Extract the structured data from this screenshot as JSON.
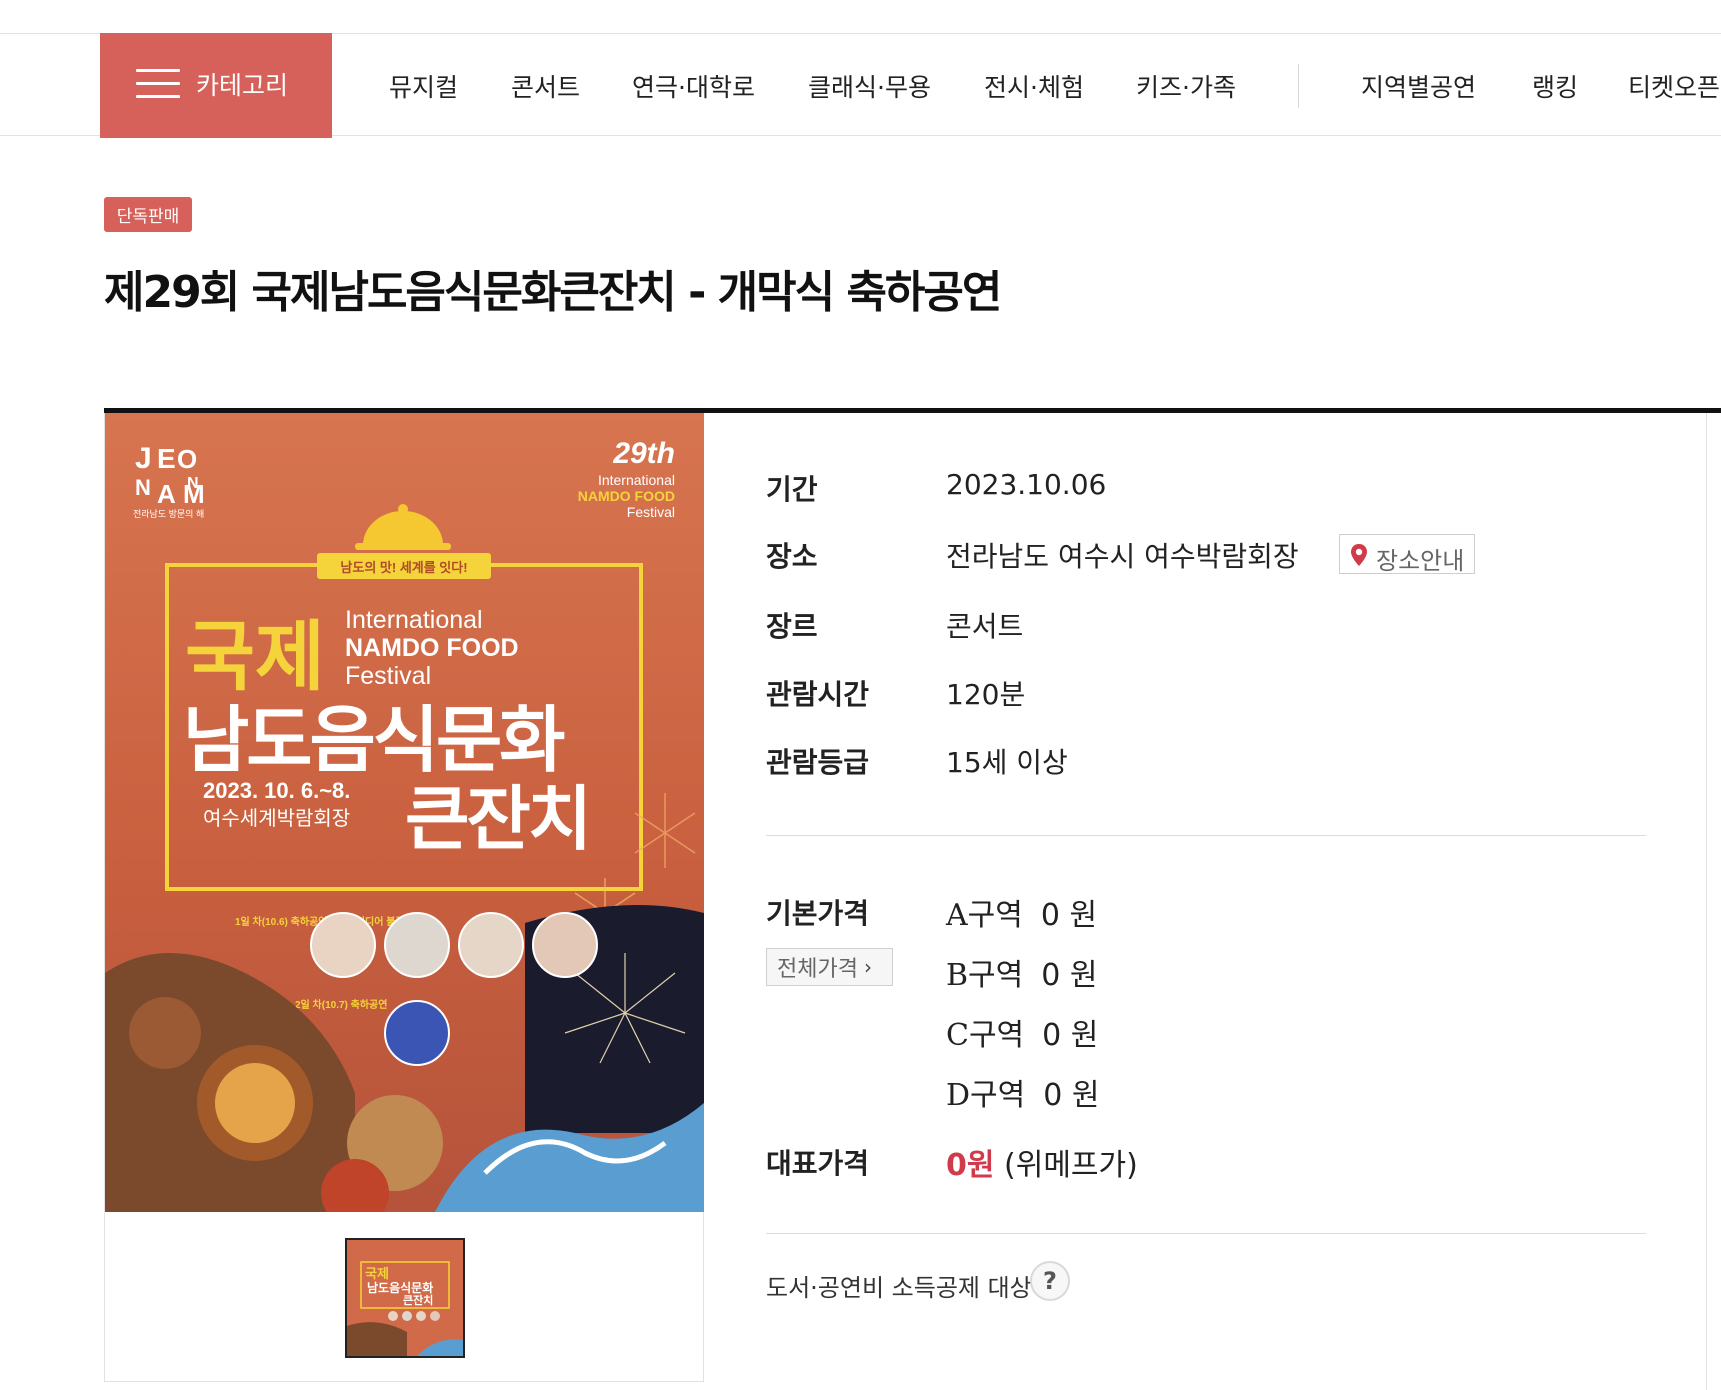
{
  "nav": {
    "category_label": "카테고리",
    "items": [
      "뮤지컬",
      "콘서트",
      "연극·대학로",
      "클래식·무용",
      "전시·체험",
      "키즈·가족",
      "지역별공연",
      "랭킹",
      "티켓오픈"
    ]
  },
  "event": {
    "badge": "단독판매",
    "title": "제29회 국제남도음식문화큰잔치 - 개막식 축하공연"
  },
  "poster": {
    "logo_letters": [
      "J",
      "E",
      "O",
      "N",
      "A",
      "M"
    ],
    "logo_sub": "전라남도 방문의 해",
    "edition": "29th",
    "edition_sub": [
      "International",
      "NAMDO FOOD",
      "Festival"
    ],
    "ribbon": "남도의 맛! 세계를 잇다!",
    "big1": "국제",
    "en_lines": [
      "International",
      "NAMDO FOOD",
      "Festival"
    ],
    "big2": "남도음식문화",
    "big3": "큰잔치",
    "dates": "2023. 10. 6.~8.",
    "place": "여수세계박람회장",
    "day1": "1일 차(10.6) 축하공연& 멀티미디어 불꽃쇼",
    "day2": "2일 차(10.7) 축하공연"
  },
  "info": {
    "period": {
      "label": "기간",
      "value": "2023.10.06"
    },
    "venue": {
      "label": "장소",
      "value": "전라남도 여수시 여수박람회장",
      "guide": "장소안내"
    },
    "genre": {
      "label": "장르",
      "value": "콘서트"
    },
    "runtime": {
      "label": "관람시간",
      "value": "120분"
    },
    "rating": {
      "label": "관람등급",
      "value": "15세 이상"
    }
  },
  "price": {
    "label": "기본가격",
    "all_button": "전체가격",
    "zones": [
      {
        "zone": "A구역",
        "amount": "0 원"
      },
      {
        "zone": "B구역",
        "amount": "0 원"
      },
      {
        "zone": "C구역",
        "amount": "0 원"
      },
      {
        "zone": "D구역",
        "amount": "0 원"
      }
    ],
    "rep_label": "대표가격",
    "rep_value": "0원",
    "rep_seller": "(위메프가)"
  },
  "deduction": {
    "text": "도서·공연비 소득공제 대상",
    "help": "?"
  },
  "colors": {
    "accent": "#d6605a",
    "price_red": "#d03a4b",
    "poster_orange": "#d77550",
    "poster_yellow": "#f5d33a"
  }
}
